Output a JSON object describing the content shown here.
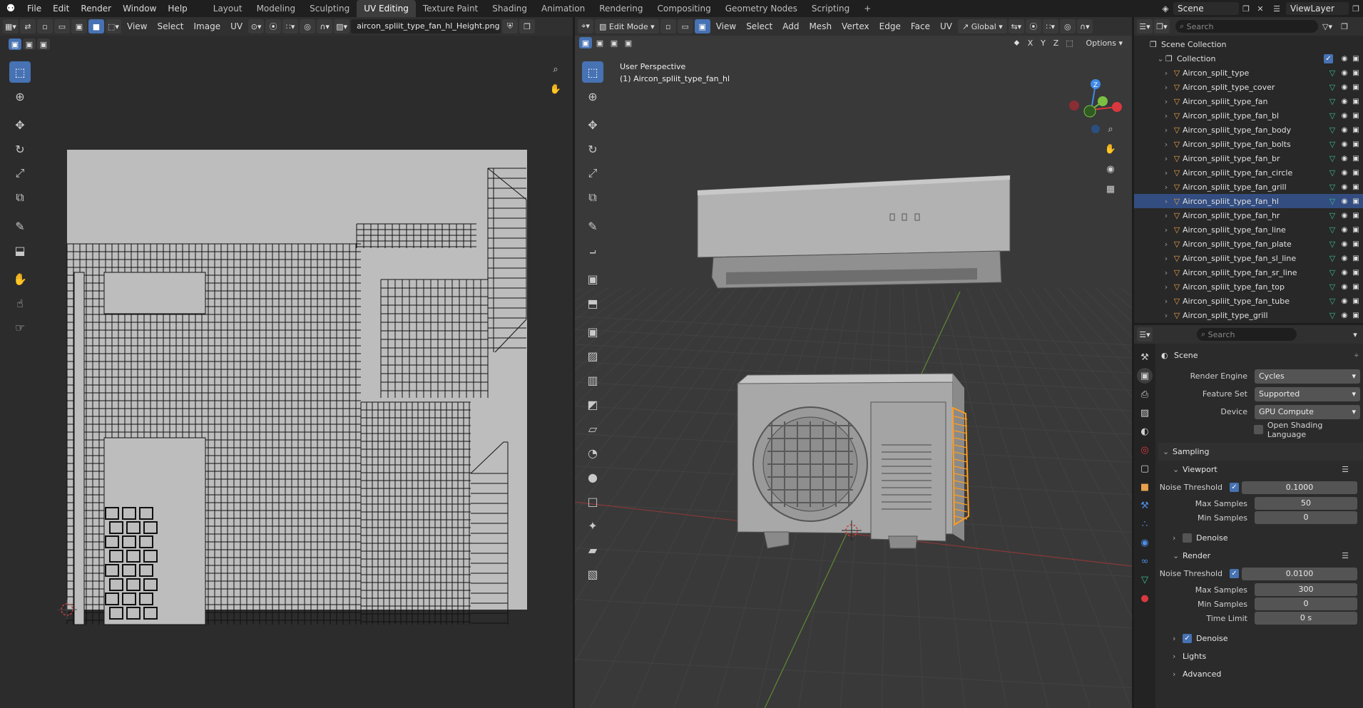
{
  "menubar": {
    "items": [
      "File",
      "Edit",
      "Render",
      "Window",
      "Help"
    ],
    "workspaces": [
      "Layout",
      "Modeling",
      "Sculpting",
      "UV Editing",
      "Texture Paint",
      "Shading",
      "Animation",
      "Rendering",
      "Compositing",
      "Geometry Nodes",
      "Scripting"
    ],
    "active_workspace": "UV Editing",
    "add_tab": "+",
    "scene": "Scene",
    "view_layer": "ViewLayer"
  },
  "uv_editor": {
    "menus": [
      "View",
      "Select",
      "Image",
      "UV"
    ],
    "image_name": "aircon_spliit_type_fan_hl_Height.png"
  },
  "viewport": {
    "mode": "Edit Mode",
    "menus": [
      "View",
      "Select",
      "Add",
      "Mesh",
      "Vertex",
      "Edge",
      "Face",
      "UV"
    ],
    "transform_orientation": "Global",
    "axes": [
      "X",
      "Y",
      "Z"
    ],
    "options_label": "Options",
    "perspective_label": "User Perspective",
    "object_label": "(1) Aircon_spliit_type_fan_hl",
    "gizmo_z": "Z",
    "colors": {
      "x_axis": "#d9383f",
      "y_axis": "#7bc043",
      "z_axis": "#3e8ae8",
      "selection": "#ff9d1f"
    }
  },
  "outliner": {
    "search_placeholder": "Search",
    "scene_collection": "Scene Collection",
    "collection": "Collection",
    "items": [
      {
        "name": "Aircon_split_type",
        "selected": false
      },
      {
        "name": "Aircon_split_type_cover",
        "selected": false
      },
      {
        "name": "Aircon_spliit_type_fan",
        "selected": false
      },
      {
        "name": "Aircon_spliit_type_fan_bl",
        "selected": false
      },
      {
        "name": "Aircon_spliit_type_fan_body",
        "selected": false
      },
      {
        "name": "Aircon_spliit_type_fan_bolts",
        "selected": false
      },
      {
        "name": "Aircon_spliit_type_fan_br",
        "selected": false
      },
      {
        "name": "Aircon_spliit_type_fan_circle",
        "selected": false
      },
      {
        "name": "Aircon_spliit_type_fan_grill",
        "selected": false
      },
      {
        "name": "Aircon_spliit_type_fan_hl",
        "selected": true
      },
      {
        "name": "Aircon_spliit_type_fan_hr",
        "selected": false
      },
      {
        "name": "Aircon_spliit_type_fan_line",
        "selected": false
      },
      {
        "name": "Aircon_spliit_type_fan_plate",
        "selected": false
      },
      {
        "name": "Aircon_spliit_type_fan_sl_line",
        "selected": false
      },
      {
        "name": "Aircon_spliit_type_fan_sr_line",
        "selected": false
      },
      {
        "name": "Aircon_spliit_type_fan_top",
        "selected": false
      },
      {
        "name": "Aircon_spliit_type_fan_tube",
        "selected": false
      },
      {
        "name": "Aircon_split_type_grill",
        "selected": false
      }
    ]
  },
  "properties": {
    "search_placeholder": "Search",
    "context_title": "Scene",
    "render_engine_label": "Render Engine",
    "render_engine": "Cycles",
    "feature_set_label": "Feature Set",
    "feature_set": "Supported",
    "device_label": "Device",
    "device": "GPU Compute",
    "osl_label": "Open Shading Language",
    "sampling_label": "Sampling",
    "viewport_label": "Viewport",
    "render_label": "Render",
    "noise_threshold_label": "Noise Threshold",
    "max_samples_label": "Max Samples",
    "min_samples_label": "Min Samples",
    "time_limit_label": "Time Limit",
    "denoise_label": "Denoise",
    "viewport_noise_threshold": "0.1000",
    "viewport_max_samples": "50",
    "viewport_min_samples": "0",
    "render_noise_threshold": "0.0100",
    "render_max_samples": "300",
    "render_min_samples": "0",
    "render_time_limit": "0 s",
    "lights_label": "Lights",
    "advanced_label": "Advanced"
  }
}
